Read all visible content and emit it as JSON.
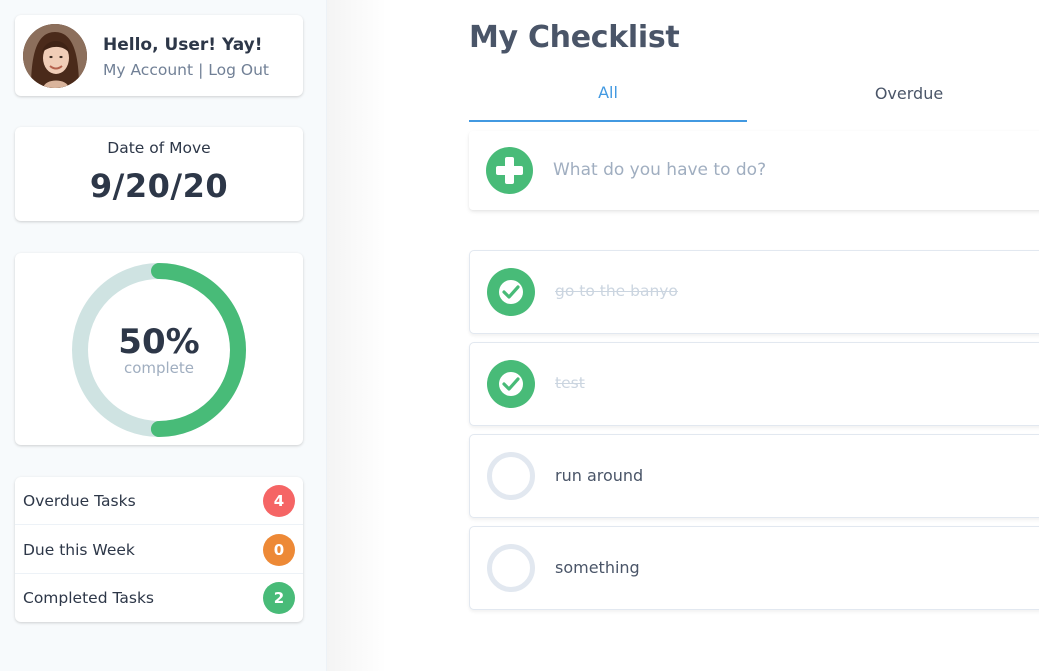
{
  "profile": {
    "greeting": "Hello, User! Yay!",
    "my_account": "My Account",
    "separator": "|",
    "log_out": "Log Out"
  },
  "move": {
    "label": "Date of Move",
    "date": "9/20/20"
  },
  "progress": {
    "percent_text": "50%",
    "sub_label": "complete",
    "fraction": 0.5,
    "track_color": "#cfe3e2",
    "fill_color": "#48bb78"
  },
  "stats": [
    {
      "label": "Overdue Tasks",
      "count": "4",
      "color": "#f56565"
    },
    {
      "label": "Due this Week",
      "count": "0",
      "color": "#ed8936"
    },
    {
      "label": "Completed Tasks",
      "count": "2",
      "color": "#48bb78"
    }
  ],
  "main": {
    "title": "My Checklist",
    "tabs": [
      {
        "label": "All",
        "active": true
      },
      {
        "label": "Overdue",
        "active": false
      }
    ],
    "add_placeholder": "What do you have to do?",
    "tasks": [
      {
        "text": "go to the banyo",
        "completed": true
      },
      {
        "text": "test",
        "completed": true
      },
      {
        "text": "run around",
        "completed": false
      },
      {
        "text": "something",
        "completed": false
      }
    ]
  },
  "colors": {
    "accent": "#4299e1",
    "success": "#48bb78"
  }
}
